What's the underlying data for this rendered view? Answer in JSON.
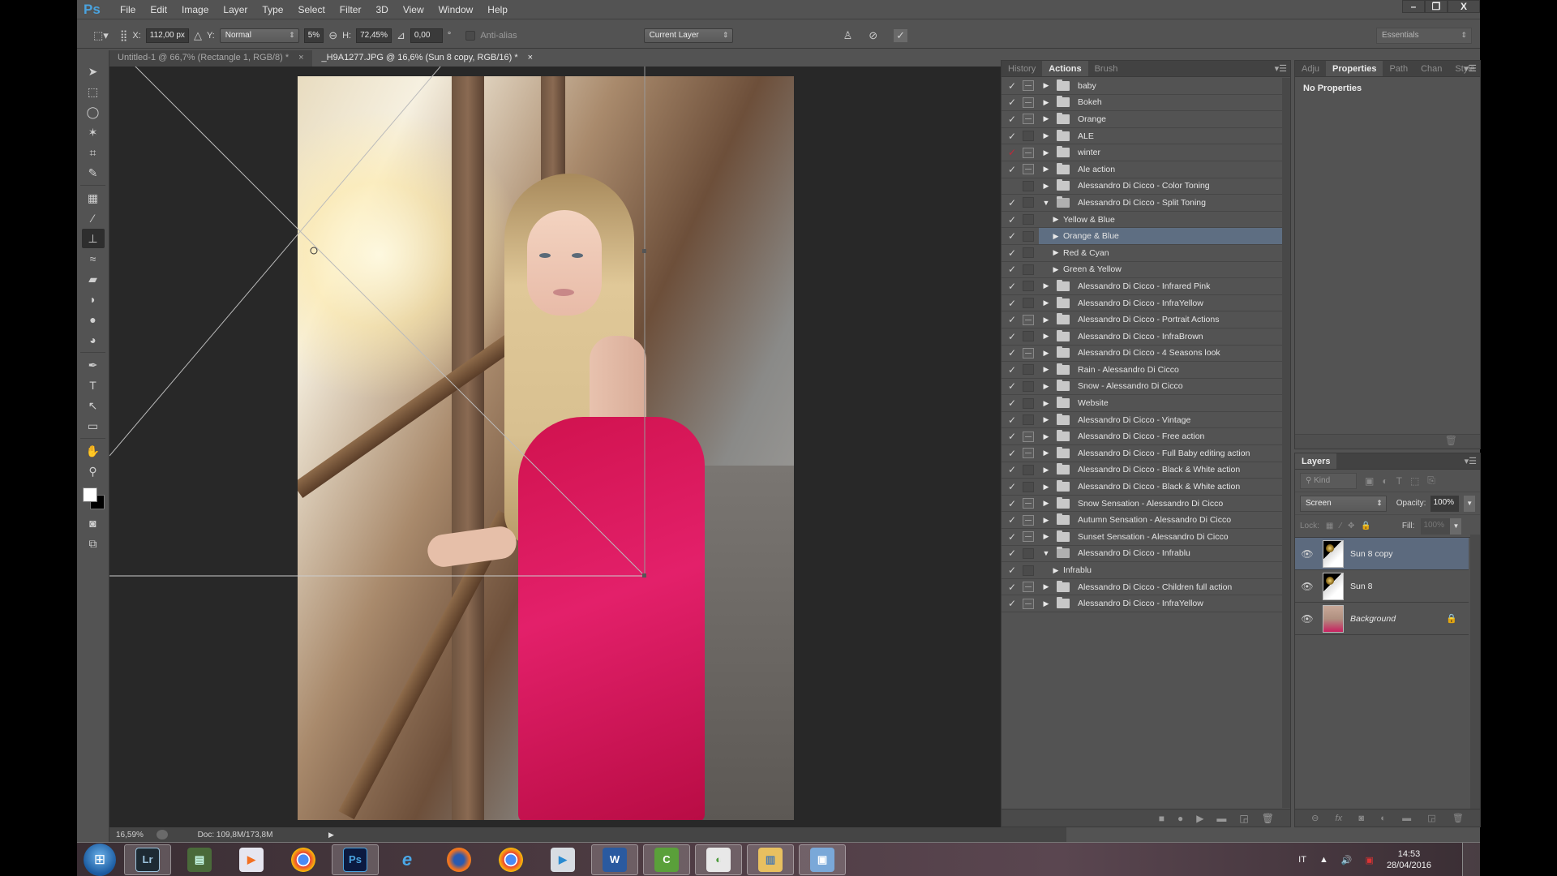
{
  "app": {
    "logo": "Ps",
    "menu": [
      "File",
      "Edit",
      "Image",
      "Layer",
      "Type",
      "Select",
      "Filter",
      "3D",
      "View",
      "Window",
      "Help"
    ],
    "window_controls": {
      "minimize": "–",
      "restore": "❐",
      "close": "X"
    }
  },
  "options_bar": {
    "x_label": "X:",
    "x_value": "112,00 px",
    "y_label": "Y:",
    "mode_value": "Normal",
    "w_value": "5%",
    "h_label": "H:",
    "h_value": "72,45%",
    "angle_value": "0,00",
    "degree_symbol": "°",
    "anti_alias_label": "Anti-alias",
    "sample_value": "Current Layer",
    "workspace": "Essentials"
  },
  "document_tabs": [
    {
      "title": "Untitled-1 @ 66,7% (Rectangle 1, RGB/8) *",
      "close": "×",
      "active": false
    },
    {
      "title": "_H9A1277.JPG @ 16,6% (Sun 8 copy, RGB/16) *",
      "close": "×",
      "active": true
    }
  ],
  "tools": [
    "move",
    "marquee",
    "lasso",
    "magic-wand",
    "crop",
    "eyedropper",
    "healing",
    "brush",
    "clone-stamp",
    "history-brush",
    "eraser",
    "paint-bucket",
    "blur",
    "dodge",
    "pen",
    "type",
    "path-select",
    "rectangle",
    "hand",
    "zoom"
  ],
  "active_tool": "clone-stamp",
  "status_bar": {
    "zoom": "16,59%",
    "doc_info": "Doc: 109,8M/173,8M"
  },
  "actions_panel": {
    "tabs": [
      "History",
      "Actions",
      "Brush"
    ],
    "active_tab": "Actions",
    "items": [
      {
        "label": "baby",
        "checked": true,
        "dialog": true,
        "type": "set"
      },
      {
        "label": "Bokeh",
        "checked": true,
        "dialog": true,
        "type": "set"
      },
      {
        "label": "Orange",
        "checked": true,
        "dialog": true,
        "type": "set"
      },
      {
        "label": "ALE",
        "checked": true,
        "dialog": false,
        "type": "set"
      },
      {
        "label": "winter",
        "checked": true,
        "red": true,
        "dialog": true,
        "type": "set"
      },
      {
        "label": "Ale action",
        "checked": true,
        "dialog": true,
        "type": "set"
      },
      {
        "label": "Alessandro Di Cicco - Color Toning",
        "checked": false,
        "dialog": false,
        "type": "set"
      },
      {
        "label": "Alessandro Di Cicco - Split Toning",
        "checked": true,
        "dialog": false,
        "type": "set",
        "expanded": true
      },
      {
        "label": "Yellow & Blue",
        "checked": true,
        "dialog": false,
        "type": "action"
      },
      {
        "label": "Orange & Blue",
        "checked": true,
        "dialog": false,
        "type": "action",
        "selected": true
      },
      {
        "label": "Red & Cyan",
        "checked": true,
        "dialog": false,
        "type": "action"
      },
      {
        "label": "Green & Yellow",
        "checked": true,
        "dialog": false,
        "type": "action"
      },
      {
        "label": "Alessandro Di Cicco - Infrared Pink",
        "checked": true,
        "dialog": false,
        "type": "set"
      },
      {
        "label": "Alessandro Di Cicco - InfraYellow",
        "checked": true,
        "dialog": false,
        "type": "set"
      },
      {
        "label": "Alessandro Di Cicco - Portrait Actions",
        "checked": true,
        "dialog": true,
        "type": "set"
      },
      {
        "label": "Alessandro Di Cicco - InfraBrown",
        "checked": true,
        "dialog": false,
        "type": "set"
      },
      {
        "label": "Alessandro Di Cicco - 4 Seasons look",
        "checked": true,
        "dialog": true,
        "type": "set"
      },
      {
        "label": "Rain - Alessandro Di Cicco",
        "checked": true,
        "dialog": false,
        "type": "set"
      },
      {
        "label": "Snow - Alessandro Di Cicco",
        "checked": true,
        "dialog": false,
        "type": "set"
      },
      {
        "label": "Website",
        "checked": true,
        "dialog": false,
        "type": "set"
      },
      {
        "label": "Alessandro Di Cicco - Vintage",
        "checked": true,
        "dialog": false,
        "type": "set"
      },
      {
        "label": "Alessandro Di Cicco - Free action",
        "checked": true,
        "dialog": true,
        "type": "set"
      },
      {
        "label": "Alessandro Di Cicco - Full Baby editing action",
        "checked": true,
        "dialog": true,
        "type": "set"
      },
      {
        "label": "Alessandro Di Cicco - Black & White action",
        "checked": true,
        "dialog": false,
        "type": "set"
      },
      {
        "label": "Alessandro Di Cicco - Black & White action",
        "checked": true,
        "dialog": false,
        "type": "set"
      },
      {
        "label": "Snow Sensation - Alessandro Di Cicco",
        "checked": true,
        "dialog": true,
        "type": "set"
      },
      {
        "label": "Autumn Sensation - Alessandro Di Cicco",
        "checked": true,
        "dialog": true,
        "type": "set"
      },
      {
        "label": "Sunset Sensation - Alessandro Di Cicco",
        "checked": true,
        "dialog": true,
        "type": "set"
      },
      {
        "label": "Alessandro Di Cicco - Infrablu",
        "checked": true,
        "dialog": false,
        "type": "set",
        "expanded": true
      },
      {
        "label": "Infrablu",
        "checked": true,
        "dialog": false,
        "type": "action"
      },
      {
        "label": "Alessandro Di Cicco - Children full action",
        "checked": true,
        "dialog": true,
        "type": "set"
      },
      {
        "label": "Alessandro Di Cicco - InfraYellow",
        "checked": true,
        "dialog": true,
        "type": "set"
      }
    ],
    "footer_buttons": [
      "stop",
      "record",
      "play",
      "new-set",
      "new-action",
      "delete"
    ]
  },
  "properties_panel": {
    "tabs": [
      "Adju",
      "Properties",
      "Path",
      "Chan",
      "Style"
    ],
    "active_tab": "Properties",
    "message": "No Properties"
  },
  "layers_panel": {
    "title": "Layers",
    "filter_kind": "Kind",
    "blend_mode": "Screen",
    "opacity_label": "Opacity:",
    "opacity": "100%",
    "lock_label": "Lock:",
    "fill_label": "Fill:",
    "fill": "100%",
    "layers": [
      {
        "name": "Sun 8 copy",
        "selected": true,
        "visible": true,
        "locked": false,
        "thumb": "sun"
      },
      {
        "name": "Sun 8",
        "selected": false,
        "visible": true,
        "locked": false,
        "thumb": "sun"
      },
      {
        "name": "Background",
        "selected": false,
        "visible": true,
        "locked": true,
        "italic": true,
        "thumb": "bg"
      }
    ],
    "footer_buttons": [
      "link",
      "fx",
      "mask",
      "adjustment",
      "group",
      "new-layer",
      "delete"
    ]
  },
  "taskbar": {
    "apps": [
      {
        "name": "Lightroom",
        "label": "Lr",
        "active": true
      },
      {
        "name": "Network Monitor",
        "label": "",
        "active": false
      },
      {
        "name": "Media Player",
        "label": "",
        "active": false
      },
      {
        "name": "Chrome",
        "label": "",
        "active": false
      },
      {
        "name": "Photoshop",
        "label": "Ps",
        "active": true
      },
      {
        "name": "Internet Explorer",
        "label": "e",
        "active": false
      },
      {
        "name": "Firefox",
        "label": "",
        "active": false
      },
      {
        "name": "Chrome",
        "label": "",
        "active": false
      },
      {
        "name": "Video Player",
        "label": "",
        "active": false
      },
      {
        "name": "Word",
        "label": "W",
        "active": true
      },
      {
        "name": "Camtasia",
        "label": "C",
        "active": true
      },
      {
        "name": "Camtasia Recorder",
        "label": "",
        "active": true
      },
      {
        "name": "File Explorer",
        "label": "",
        "active": true
      },
      {
        "name": "Screen",
        "label": "",
        "active": true
      }
    ],
    "tray": {
      "language": "IT",
      "time": "14:53",
      "date": "28/04/2016"
    }
  },
  "colors": {
    "panel_bg": "#535353",
    "canvas_bg": "#282828",
    "selection": "#5e6e82",
    "accent_ps": "#4aa3df",
    "dress": "#d0124e"
  }
}
